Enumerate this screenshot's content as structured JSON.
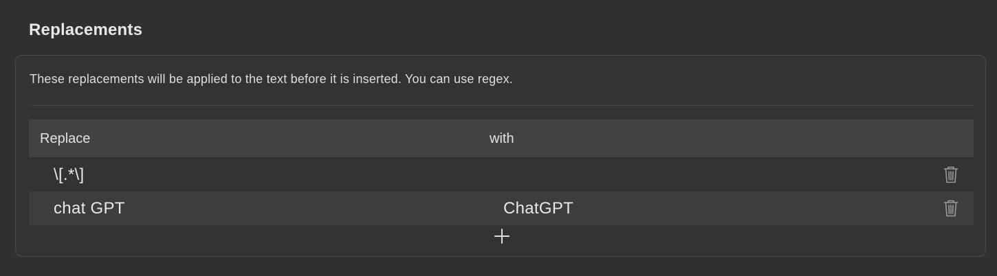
{
  "section": {
    "title": "Replacements"
  },
  "panel": {
    "description": "These replacements will be applied to the text before it is inserted. You can use regex."
  },
  "table": {
    "columns": {
      "replace": "Replace",
      "with": "with"
    },
    "rows": [
      {
        "replace": "\\[.*\\]",
        "with": ""
      },
      {
        "replace": "chat GPT",
        "with": "ChatGPT"
      }
    ]
  },
  "icons": {
    "delete": "trash-icon",
    "add": "plus-icon"
  },
  "colors": {
    "background": "#2f302f",
    "header_row": "#414241",
    "alt_row": "#3c3d3c",
    "icon": "#9a9a9a"
  }
}
